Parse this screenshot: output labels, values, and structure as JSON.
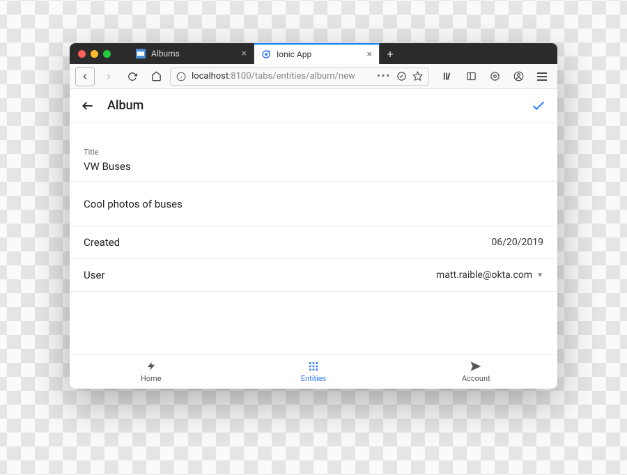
{
  "browser": {
    "tabs": [
      {
        "label": "Albums"
      },
      {
        "label": "Ionic App"
      }
    ],
    "url_display_prefix": "localhost",
    "url_display_rest": ":8100/tabs/entities/album/new"
  },
  "header": {
    "title": "Album"
  },
  "form": {
    "title_label": "Title",
    "title_value": "VW Buses",
    "description_value": "Cool photos of buses",
    "created_label": "Created",
    "created_value": "06/20/2019",
    "user_label": "User",
    "user_value": "matt.raible@okta.com"
  },
  "tabs": {
    "home": "Home",
    "entities": "Entities",
    "account": "Account"
  }
}
